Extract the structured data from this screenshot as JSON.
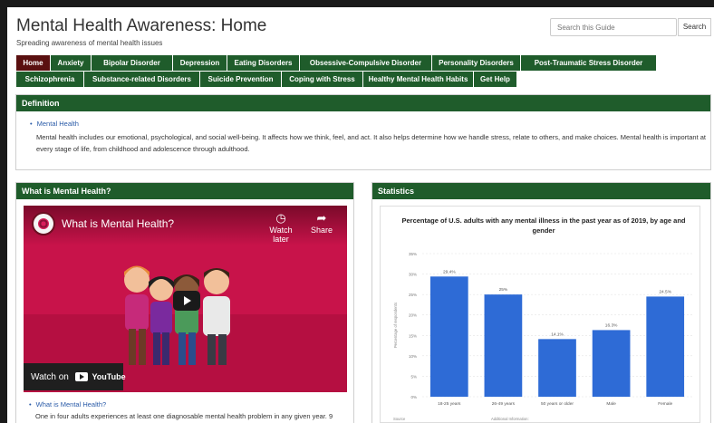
{
  "header": {
    "title": "Mental Health Awareness: Home",
    "subtitle": "Spreading awareness of mental health issues",
    "search_placeholder": "Search this Guide",
    "search_button": "Search"
  },
  "nav": {
    "row1": [
      "Home",
      "Anxiety",
      "Bipolar Disorder",
      "Depression",
      "Eating Disorders",
      "Obsessive-Compulsive Disorder",
      "Personality Disorders",
      "Post-Traumatic Stress Disorder"
    ],
    "row2": [
      "Schizophrenia",
      "Substance-related Disorders",
      "Suicide Prevention",
      "Coping with Stress",
      "Healthy Mental Health Habits",
      "Get Help"
    ],
    "active": "Home",
    "colors": {
      "tab": "#1f5c2b",
      "active_tab": "#5a1010"
    }
  },
  "definition": {
    "heading": "Definition",
    "link": "Mental Health",
    "text": "Mental health includes our emotional, psychological, and social well-being. It affects how we think, feel, and act. It also helps determine how we handle stress, relate to others, and make choices. Mental health is important at every stage of life, from childhood and adolescence through adulthood."
  },
  "what_is": {
    "heading": "What is Mental Health?",
    "video": {
      "title": "What is Mental Health?",
      "watch_later": "Watch later",
      "share": "Share",
      "watch_on": "Watch on",
      "youtube": "YouTube"
    },
    "link": "What is Mental Health?",
    "text": "One in four adults experiences at least one diagnosable mental health problem in any given year. 9"
  },
  "statistics": {
    "heading": "Statistics"
  },
  "chart_data": {
    "type": "bar",
    "title": "Percentage of U.S. adults with any mental illness in the past year as of 2019, by age and gender",
    "ylabel": "Percentage of respondents",
    "categories": [
      "18-25 years",
      "26-49 years",
      "50 years or older",
      "Male",
      "Female"
    ],
    "values": [
      29.4,
      25,
      14.1,
      16.3,
      24.5
    ],
    "value_labels": [
      "29.4%",
      "25%",
      "14.1%",
      "16.3%",
      "24.5%"
    ],
    "ylim": [
      0,
      35
    ],
    "yticks": [
      "0%",
      "5%",
      "10%",
      "15%",
      "20%",
      "25%",
      "30%",
      "35%"
    ],
    "bar_color": "#2e6bd6",
    "grid": true,
    "footer": [
      "Source",
      "Additional Information:"
    ]
  }
}
